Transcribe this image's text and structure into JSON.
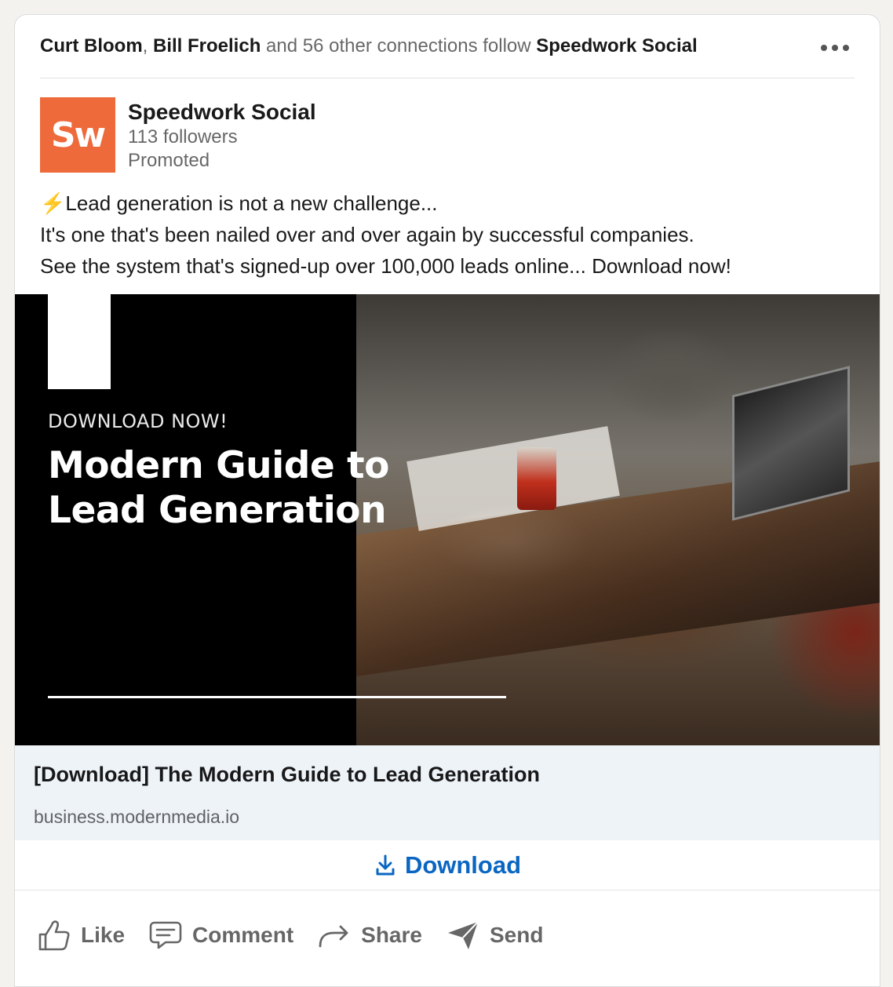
{
  "social_header": {
    "person1": "Curt Bloom",
    "separator": ",",
    "person2": "Bill Froelich",
    "middle_text": "and 56 other connections follow",
    "company": "Speedwork Social",
    "more_icon": "ellipsis-icon"
  },
  "actor": {
    "logo_text": "Sw",
    "logo_color": "#ee6a3a",
    "name": "Speedwork Social",
    "followers": "113 followers",
    "label": "Promoted"
  },
  "commentary": {
    "bolt": "⚡",
    "line1": "Lead generation is not a new challenge...",
    "line2": "It's one that's been nailed over and over again by successful companies.",
    "line3": "See the system that's signed-up over 100,000 leads online... Download now!"
  },
  "media": {
    "kicker": "DOWNLOAD NOW!",
    "title_line1": "Modern Guide to",
    "title_line2": "Lead Generation"
  },
  "link_preview": {
    "title": "[Download] The Modern Guide to Lead Generation",
    "domain": "business.modernmedia.io"
  },
  "cta": {
    "label": "Download",
    "icon": "download-icon",
    "color": "#0a66c2"
  },
  "actions": {
    "like": "Like",
    "comment": "Comment",
    "share": "Share",
    "send": "Send"
  }
}
